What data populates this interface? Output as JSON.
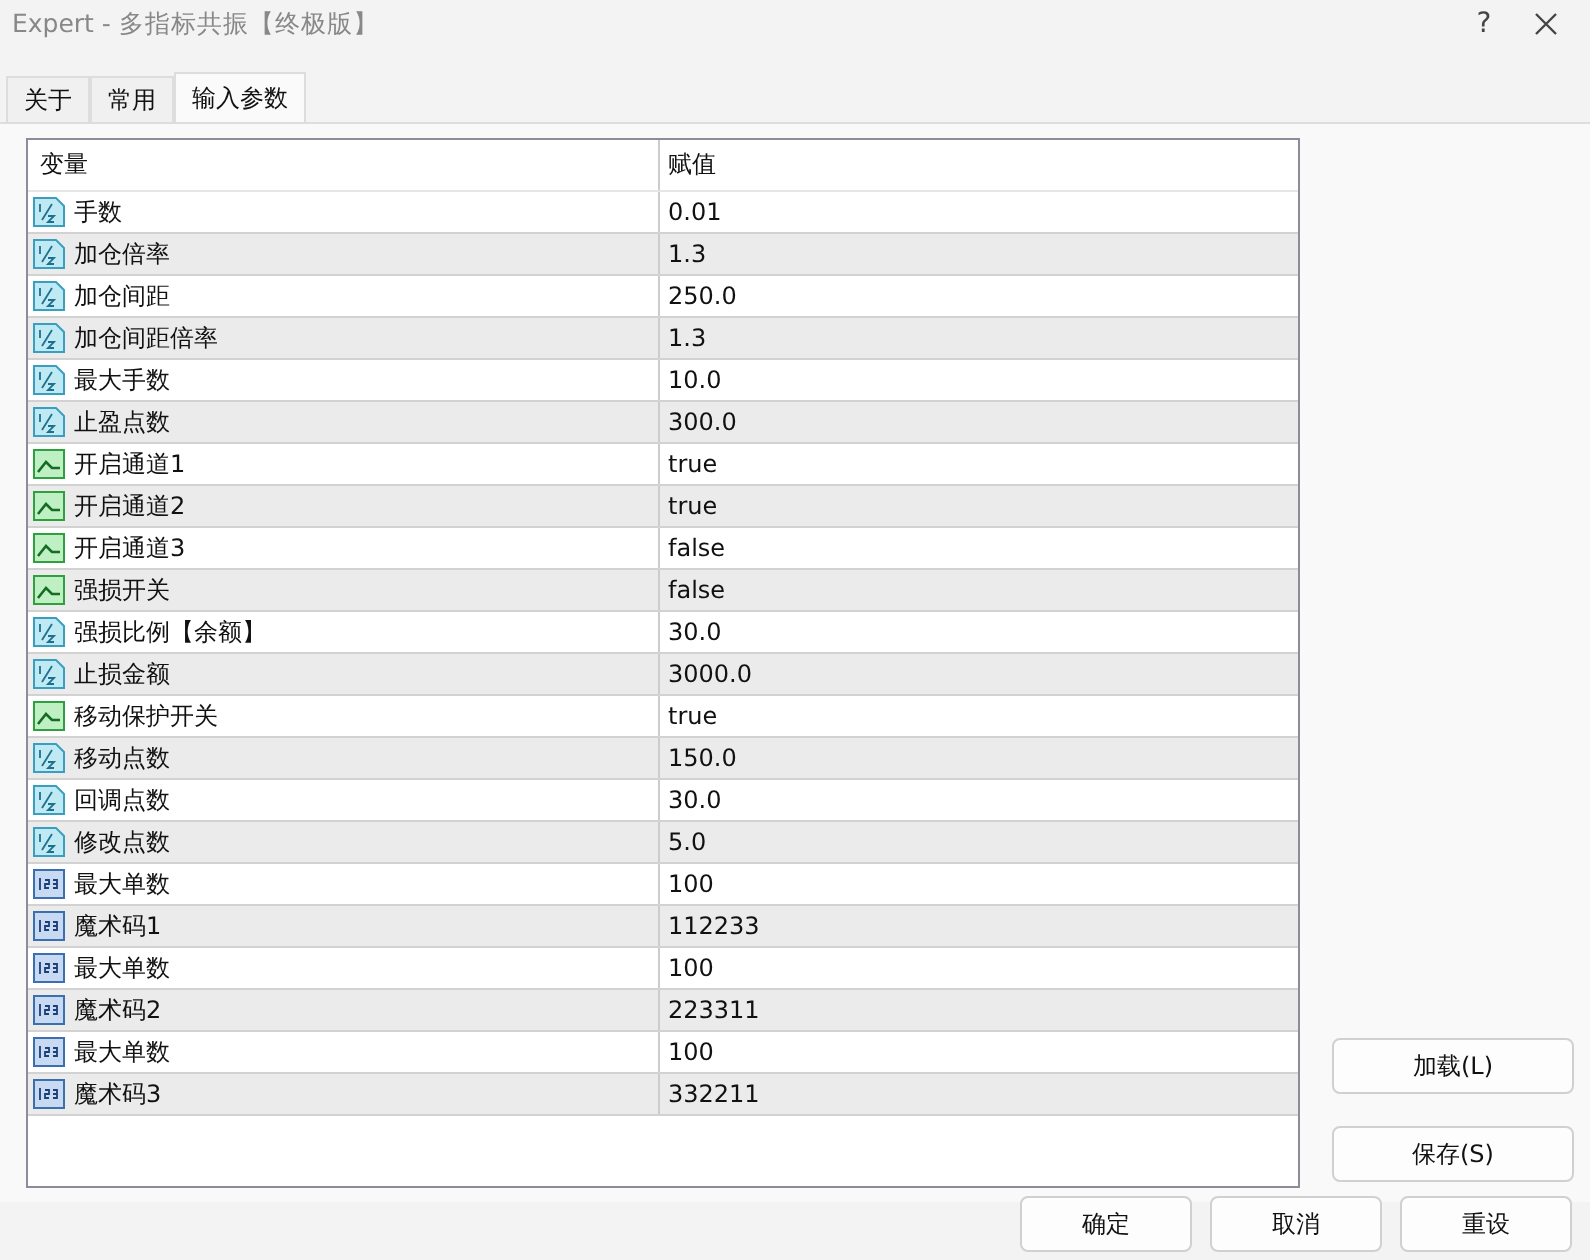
{
  "window": {
    "title": "Expert - 多指标共振【终极版】",
    "help": "?"
  },
  "tabs": [
    {
      "label": "关于",
      "selected": false
    },
    {
      "label": "常用",
      "selected": false
    },
    {
      "label": "输入参数",
      "selected": true
    }
  ],
  "table": {
    "columns": [
      "变量",
      "赋值"
    ],
    "rows": [
      {
        "kind": "double",
        "name": "手数",
        "value": "0.01"
      },
      {
        "kind": "double",
        "name": "加仓倍率",
        "value": "1.3"
      },
      {
        "kind": "double",
        "name": "加仓间距",
        "value": "250.0"
      },
      {
        "kind": "double",
        "name": "加仓间距倍率",
        "value": "1.3"
      },
      {
        "kind": "double",
        "name": "最大手数",
        "value": "10.0"
      },
      {
        "kind": "double",
        "name": "止盈点数",
        "value": "300.0"
      },
      {
        "kind": "bool",
        "name": "开启通道1",
        "value": "true"
      },
      {
        "kind": "bool",
        "name": "开启通道2",
        "value": "true"
      },
      {
        "kind": "bool",
        "name": "开启通道3",
        "value": "false"
      },
      {
        "kind": "bool",
        "name": "强损开关",
        "value": "false"
      },
      {
        "kind": "double",
        "name": "强损比例【余额】",
        "value": "30.0"
      },
      {
        "kind": "double",
        "name": "止损金额",
        "value": "3000.0"
      },
      {
        "kind": "bool",
        "name": "移动保护开关",
        "value": "true"
      },
      {
        "kind": "double",
        "name": "移动点数",
        "value": "150.0"
      },
      {
        "kind": "double",
        "name": "回调点数",
        "value": "30.0"
      },
      {
        "kind": "double",
        "name": "修改点数",
        "value": "5.0"
      },
      {
        "kind": "int",
        "name": "最大单数",
        "value": "100"
      },
      {
        "kind": "int",
        "name": "魔术码1",
        "value": "112233"
      },
      {
        "kind": "int",
        "name": "最大单数",
        "value": "100"
      },
      {
        "kind": "int",
        "name": "魔术码2",
        "value": "223311"
      },
      {
        "kind": "int",
        "name": "最大单数",
        "value": "100"
      },
      {
        "kind": "int",
        "name": "魔术码3",
        "value": "332211"
      }
    ]
  },
  "side_buttons": [
    "加载(L)",
    "保存(S)"
  ],
  "buttons": [
    "确定",
    "取消",
    "重设"
  ]
}
